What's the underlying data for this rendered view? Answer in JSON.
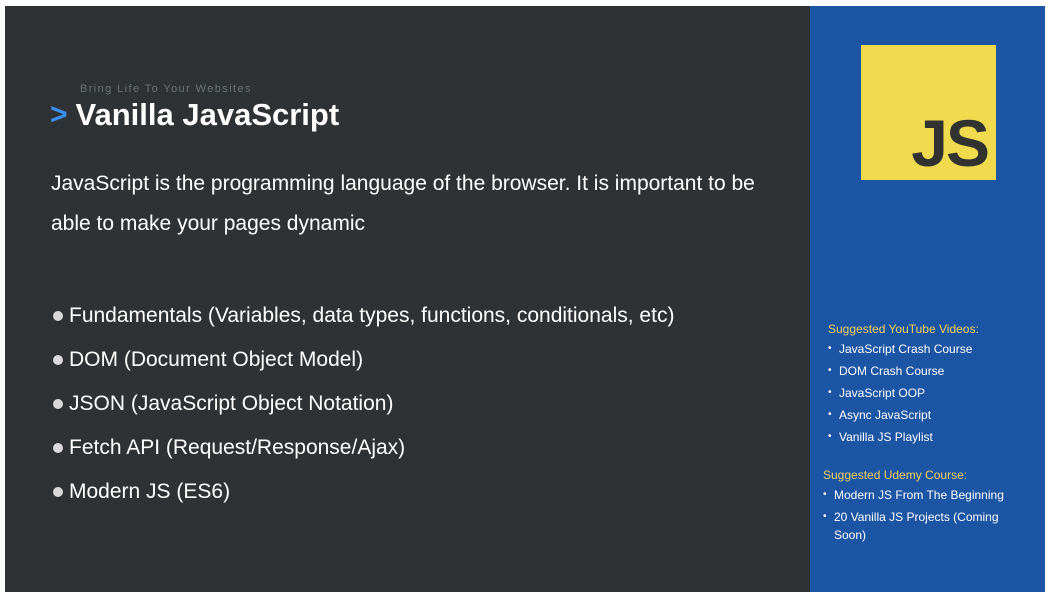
{
  "main": {
    "kicker": "Bring Life To Your Websites",
    "chevron": ">",
    "title": "Vanilla JavaScript",
    "intro": "JavaScript is the programming language of the browser. It is important to be able to make your pages dynamic",
    "topics": [
      "Fundamentals (Variables, data types, functions, conditionals, etc)",
      "DOM (Document Object Model)",
      "JSON (JavaScript Object Notation)",
      "Fetch API (Request/Response/Ajax)",
      "Modern JS (ES6)"
    ]
  },
  "sidebar": {
    "logo_text": "JS",
    "youtube": {
      "title": "Suggested YouTube Videos:",
      "items": [
        "JavaScript Crash Course",
        "DOM Crash Course",
        "JavaScript OOP",
        "Async JavaScript",
        "Vanilla JS Playlist"
      ]
    },
    "udemy": {
      "title": "Suggested Udemy Course:",
      "items": [
        "Modern JS From The Beginning",
        "20 Vanilla JS Projects (Coming Soon)"
      ]
    },
    "bullet": "•"
  },
  "colors": {
    "main_bg": "#2e3234",
    "side_bg": "#1c55a3",
    "accent_blue": "#3b8ff0",
    "js_yellow": "#f0db4f",
    "heading_yellow": "#f3d15a"
  }
}
